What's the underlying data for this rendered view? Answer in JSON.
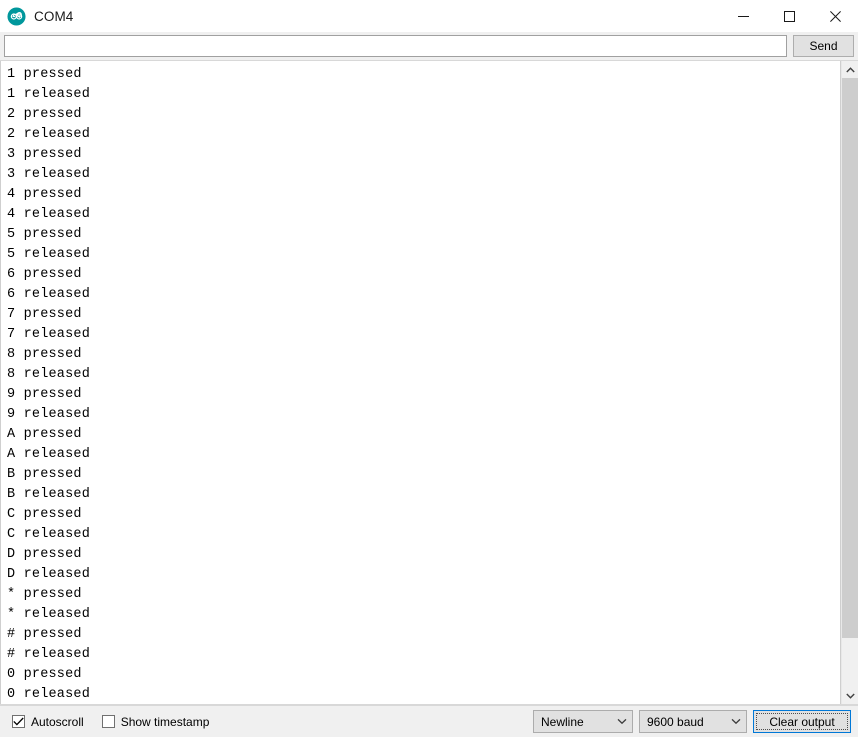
{
  "window": {
    "title": "COM4",
    "logo_icon": "arduino-infinity-logo",
    "controls": [
      {
        "name": "minimize",
        "icon": "minimize-icon"
      },
      {
        "name": "maximize",
        "icon": "maximize-icon"
      },
      {
        "name": "close",
        "icon": "close-icon"
      }
    ]
  },
  "send_row": {
    "input_value": "",
    "input_placeholder": "",
    "send_label": "Send"
  },
  "output": {
    "lines": [
      "1 pressed",
      "1 released",
      "2 pressed",
      "2 released",
      "3 pressed",
      "3 released",
      "4 pressed",
      "4 released",
      "5 pressed",
      "5 released",
      "6 pressed",
      "6 released",
      "7 pressed",
      "7 released",
      "8 pressed",
      "8 released",
      "9 pressed",
      "9 released",
      "A pressed",
      "A released",
      "B pressed",
      "B released",
      "C pressed",
      "C released",
      "D pressed",
      "D released",
      "* pressed",
      "* released",
      "# pressed",
      "# released",
      "0 pressed",
      "0 released"
    ]
  },
  "scrollbar": {
    "up_icon": "chevron-up-icon",
    "down_icon": "chevron-down-icon",
    "thumb_percent": 92
  },
  "status_bar": {
    "autoscroll_label": "Autoscroll",
    "autoscroll_checked": true,
    "timestamp_label": "Show timestamp",
    "timestamp_checked": false,
    "line_ending_value": "Newline",
    "baud_value": "9600 baud",
    "clear_label": "Clear output"
  },
  "colors": {
    "accent": "#0078d7",
    "arduino_teal": "#00979c",
    "close_hover": "#e81123",
    "chrome": "#f0f0f0",
    "scroll_thumb": "#cdcdcd"
  }
}
